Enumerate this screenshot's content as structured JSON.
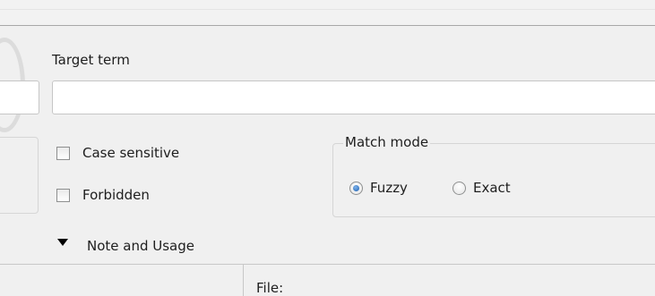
{
  "target_term": {
    "label": "Target term",
    "value": ""
  },
  "options": {
    "case_sensitive_label": "Case sensitive",
    "case_sensitive_checked": false,
    "forbidden_label": "Forbidden",
    "forbidden_checked": false
  },
  "match_mode": {
    "legend": "Match mode",
    "options": [
      {
        "label": "Fuzzy",
        "selected": true
      },
      {
        "label": "Exact",
        "selected": false
      }
    ]
  },
  "note_section": {
    "label": "Note and Usage",
    "expanded": true
  },
  "file": {
    "label": "File:"
  },
  "colors": {
    "background": "#f0f0f0",
    "radio_accent": "#1c5fae",
    "border": "#c6c6c6"
  }
}
